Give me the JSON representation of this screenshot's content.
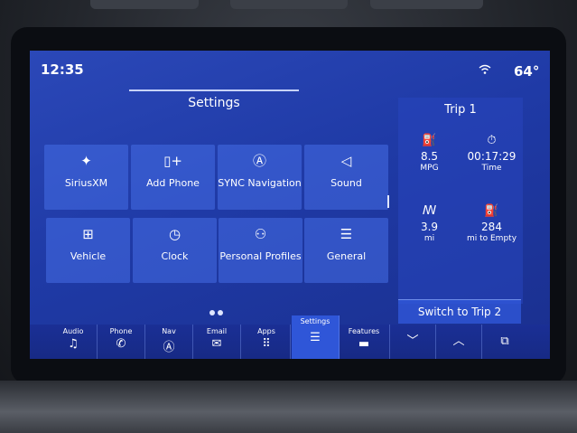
{
  "status": {
    "time": "12:35",
    "temperature": "64°",
    "wifi_icon": "wifi-icon"
  },
  "settings": {
    "title": "Settings",
    "tiles": [
      {
        "label": "SiriusXM",
        "icon": "satellite-icon",
        "glyph": "✦"
      },
      {
        "label": "Add Phone",
        "icon": "add-phone-icon",
        "glyph": "▯+"
      },
      {
        "label": "SYNC Navigation",
        "icon": "navigation-icon",
        "glyph": "Ⓐ"
      },
      {
        "label": "Sound",
        "icon": "speaker-icon",
        "glyph": "◁"
      },
      {
        "label": "Vehicle",
        "icon": "vehicle-settings-icon",
        "glyph": "⊞"
      },
      {
        "label": "Clock",
        "icon": "clock-icon",
        "glyph": "◷"
      },
      {
        "label": "Personal Profiles",
        "icon": "profiles-icon",
        "glyph": "⚇"
      },
      {
        "label": "General",
        "icon": "sliders-icon",
        "glyph": "☰"
      }
    ]
  },
  "trip": {
    "title": "Trip 1",
    "stats": [
      {
        "value": "8.5",
        "unit": "MPG",
        "icon": "fuel-economy-icon",
        "glyph": "⛽"
      },
      {
        "value": "00:17:29",
        "unit": "Time",
        "icon": "stopwatch-icon",
        "glyph": "⏱"
      },
      {
        "value": "3.9",
        "unit": "mi",
        "icon": "distance-icon",
        "glyph": "ꟿ"
      },
      {
        "value": "284",
        "unit": "mi to Empty",
        "icon": "fuel-pump-icon",
        "glyph": "⛽"
      }
    ],
    "switch_label": "Switch to Trip 2"
  },
  "navbar": {
    "items": [
      {
        "label": "Audio",
        "icon": "music-note-icon",
        "glyph": "♫"
      },
      {
        "label": "Phone",
        "icon": "phone-icon",
        "glyph": "✆"
      },
      {
        "label": "Nav",
        "icon": "nav-icon",
        "glyph": "Ⓐ"
      },
      {
        "label": "Email",
        "icon": "email-icon",
        "glyph": "✉"
      },
      {
        "label": "Apps",
        "icon": "apps-grid-icon",
        "glyph": "⠿"
      },
      {
        "label": "Settings",
        "icon": "settings-sliders-icon",
        "glyph": "☰"
      },
      {
        "label": "Features",
        "icon": "truck-icon",
        "glyph": "▬"
      }
    ],
    "active": "Settings",
    "buttons": [
      {
        "icon": "chevron-down-icon",
        "glyph": "﹀"
      },
      {
        "icon": "chevron-up-icon",
        "glyph": "︿"
      },
      {
        "icon": "windows-icon",
        "glyph": "⧉"
      }
    ]
  },
  "colors": {
    "screen_blue": "#1f3aa6",
    "tile_blue": "#4a6ee6",
    "active_tab": "#2f56d8"
  }
}
